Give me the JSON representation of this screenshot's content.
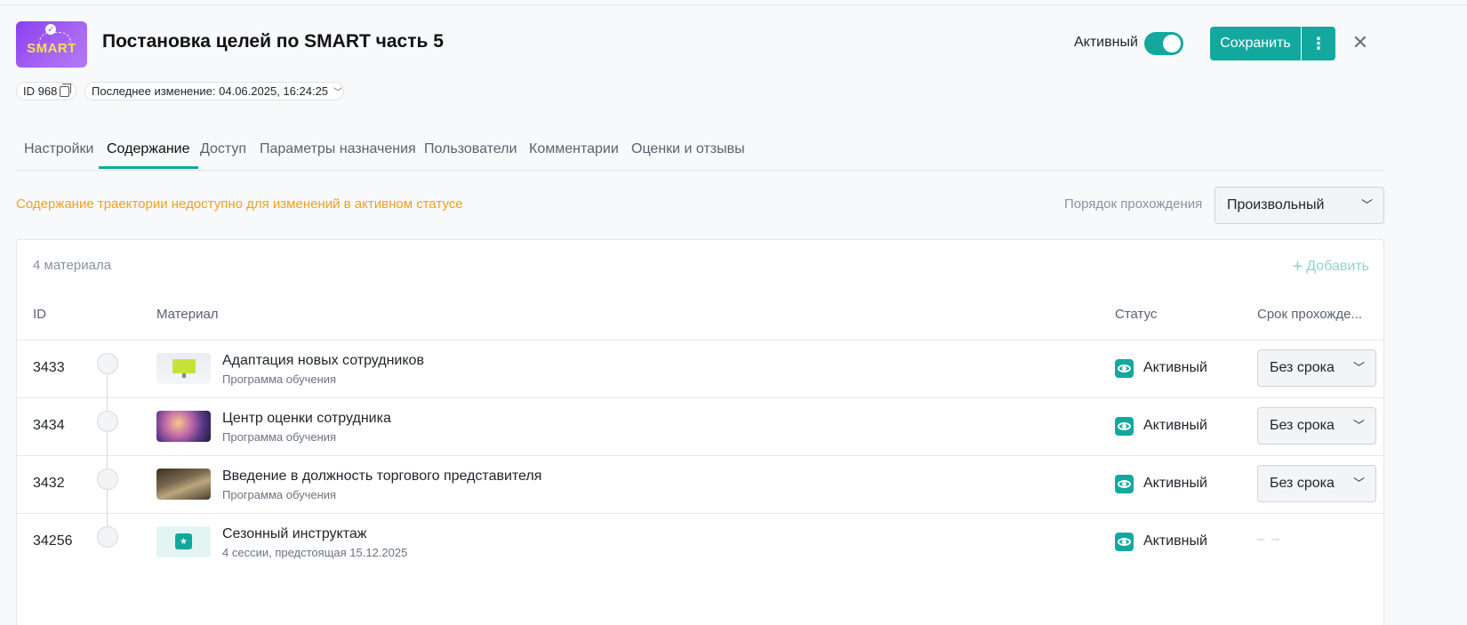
{
  "header": {
    "logo_text": "SMART",
    "title": "Постановка целей по SMART часть 5",
    "active_label": "Активный",
    "save_label": "Сохранить"
  },
  "meta": {
    "id_label": "ID 968",
    "last_change": "Последнее изменение: 04.06.2025, 16:24:25"
  },
  "tabs": [
    {
      "label": "Настройки"
    },
    {
      "label": "Содержание"
    },
    {
      "label": "Доступ"
    },
    {
      "label": "Параметры назначения"
    },
    {
      "label": "Пользователи"
    },
    {
      "label": "Комментарии"
    },
    {
      "label": "Оценки и отзывы"
    }
  ],
  "content": {
    "warning": "Содержание траектории недоступно для изменений в активном статусе",
    "order_label": "Порядок прохождения",
    "order_value": "Произвольный",
    "count": "4 материала",
    "add_label": "Добавить",
    "columns": {
      "id": "ID",
      "material": "Материал",
      "status": "Статус",
      "deadline": "Срок прохожде..."
    },
    "rows": [
      {
        "id": "3433",
        "name": "Адаптация новых сотрудников",
        "sub": "Программа обучения",
        "status": "Активный",
        "deadline": "Без срока"
      },
      {
        "id": "3434",
        "name": "Центр оценки сотрудника",
        "sub": "Программа обучения",
        "status": "Активный",
        "deadline": "Без срока"
      },
      {
        "id": "3432",
        "name": "Введение в должность торгового представителя",
        "sub": "Программа обучения",
        "status": "Активный",
        "deadline": "Без срока"
      },
      {
        "id": "34256",
        "name": "Сезонный инструктаж",
        "sub": "4 сессии, предстоящая 15.12.2025",
        "status": "Активный",
        "deadline": "– –"
      }
    ]
  },
  "colors": {
    "accent": "#13a89e",
    "warning": "#f0a020"
  },
  "icons": {
    "copy": "copy-icon",
    "chevron": "chevron-down-icon",
    "close": "close-icon",
    "more": "more-vertical-icon",
    "plus": "plus-icon",
    "status": "eye-icon"
  }
}
